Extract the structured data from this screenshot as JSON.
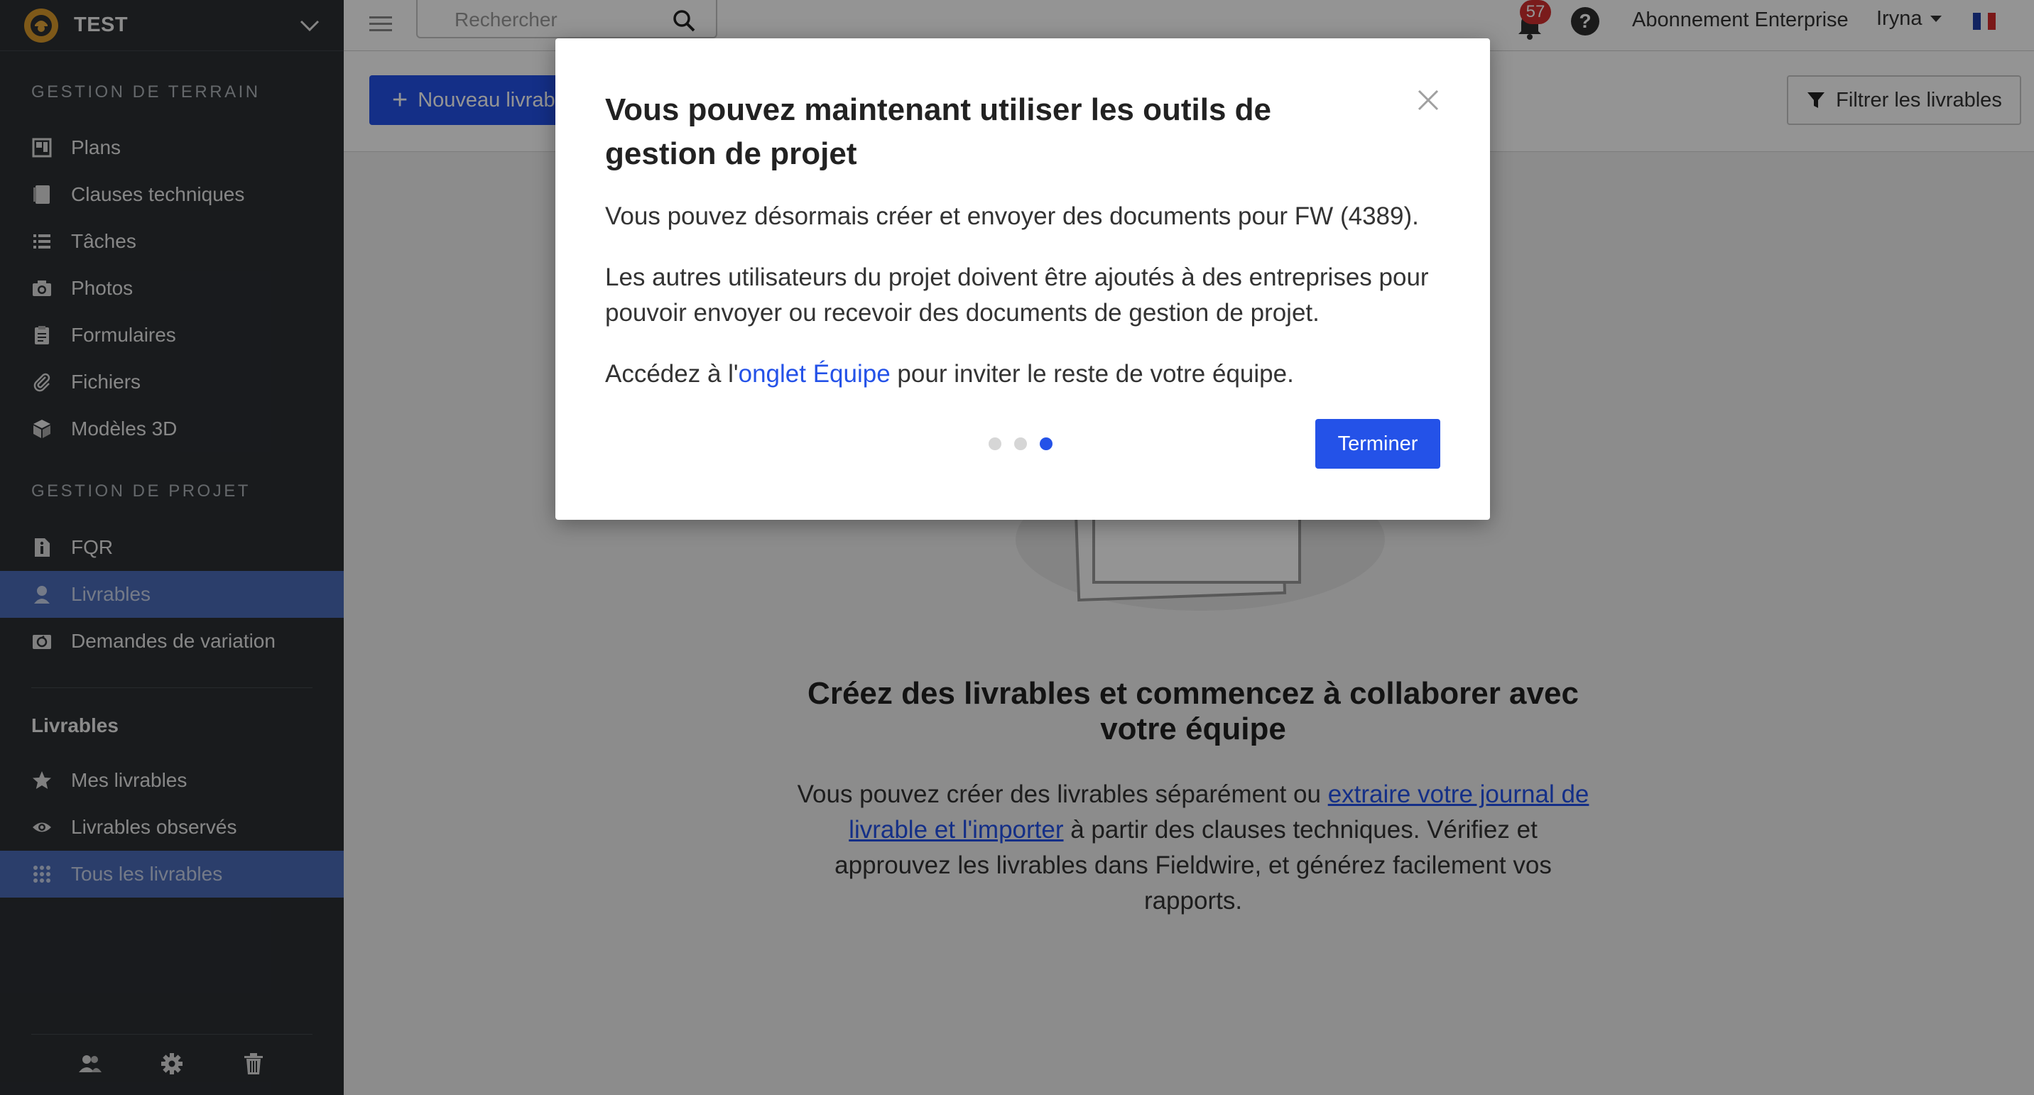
{
  "project": {
    "name": "TEST"
  },
  "sidebar": {
    "field_section": "GESTION DE TERRAIN",
    "field_items": [
      {
        "label": "Plans",
        "icon": "plans-icon"
      },
      {
        "label": "Clauses techniques",
        "icon": "specs-icon"
      },
      {
        "label": "Tâches",
        "icon": "tasks-icon"
      },
      {
        "label": "Photos",
        "icon": "camera-icon"
      },
      {
        "label": "Formulaires",
        "icon": "clipboard-icon"
      },
      {
        "label": "Fichiers",
        "icon": "paperclip-icon"
      },
      {
        "label": "Modèles 3D",
        "icon": "cube-icon"
      }
    ],
    "pm_section": "GESTION DE PROJET",
    "pm_items": [
      {
        "label": "FQR",
        "icon": "rfi-icon"
      },
      {
        "label": "Livrables",
        "icon": "submittal-icon",
        "active": true
      },
      {
        "label": "Demandes de variation",
        "icon": "change-order-icon"
      }
    ],
    "sub_title": "Livrables",
    "sub_items": [
      {
        "label": "Mes livrables",
        "icon": "star-icon"
      },
      {
        "label": "Livrables observés",
        "icon": "eye-icon"
      },
      {
        "label": "Tous les livrables",
        "icon": "grid-icon",
        "active": true
      }
    ]
  },
  "topbar": {
    "search_placeholder": "Rechercher",
    "notification_count": "57",
    "help": "?",
    "plan": "Abonnement Enterprise",
    "user": "Iryna"
  },
  "toolbar": {
    "new_label": "Nouveau livrable",
    "filter_label": "Filtrer les livrables"
  },
  "empty_state": {
    "title": "Créez des livrables et commencez à collaborer avec votre équipe",
    "text_before": "Vous pouvez créer des livrables séparément ou ",
    "link": "extraire votre journal de livrable et l'importer",
    "text_after": " à partir des clauses techniques. Vérifiez et approuvez les livrables dans Fieldwire, et générez facilement vos rapports."
  },
  "modal": {
    "title": "Vous pouvez maintenant utiliser les outils de gestion de projet",
    "p1": "Vous pouvez désormais créer et envoyer des documents pour FW (4389).",
    "p2": "Les autres utilisateurs du projet doivent être ajoutés à des entreprises pour pouvoir envoyer ou recevoir des documents de gestion de projet.",
    "p3_before": "Accédez à l'",
    "p3_link": "onglet Équipe",
    "p3_after": " pour inviter le reste de votre équipe.",
    "step_current": 3,
    "step_total": 3,
    "finish_label": "Terminer"
  },
  "colors": {
    "accent": "#2452e8",
    "sidebar_bg": "#2b2f33",
    "active_bg": "#4a6cb8",
    "badge": "#d32f2f"
  }
}
